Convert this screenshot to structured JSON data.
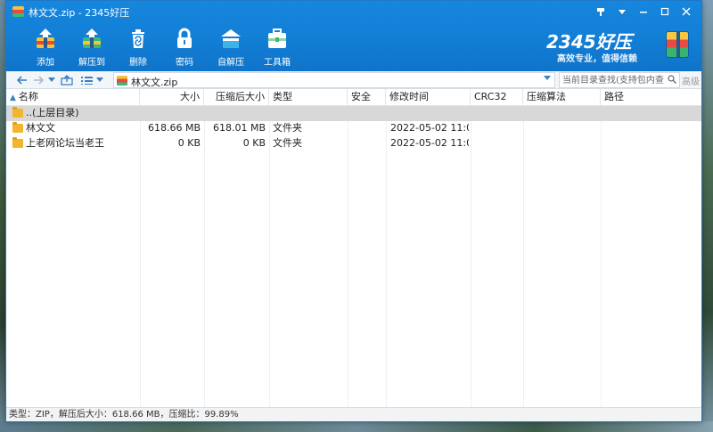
{
  "window": {
    "title": "林文文.zip - 2345好压",
    "controls": [
      "pin-icon",
      "menu-icon",
      "minimize-icon",
      "maximize-icon",
      "close-icon"
    ]
  },
  "toolbar": {
    "items": [
      {
        "label": "添加",
        "icon": "add-archive-icon"
      },
      {
        "label": "解压到",
        "icon": "extract-to-icon"
      },
      {
        "label": "删除",
        "icon": "delete-icon"
      },
      {
        "label": "密码",
        "icon": "lock-icon"
      },
      {
        "label": "自解压",
        "icon": "self-extract-icon"
      },
      {
        "label": "工具箱",
        "icon": "toolbox-icon"
      }
    ]
  },
  "brand": {
    "logo": "2345好压",
    "slogan": "高效专业，值得信赖"
  },
  "address": {
    "path": "林文文.zip",
    "search_placeholder": "当前目录查找(支持包内查",
    "advanced_label": "高级"
  },
  "columns": [
    "名称",
    "大小",
    "压缩后大小",
    "类型",
    "安全",
    "修改时间",
    "CRC32",
    "压缩算法",
    "路径"
  ],
  "rows": [
    {
      "name": "..(上层目录)",
      "size": "",
      "packed": "",
      "type": "",
      "security": "",
      "modified": "",
      "crc": "",
      "method": "",
      "path": "",
      "selected": true
    },
    {
      "name": "林文文",
      "size": "618.66 MB",
      "packed": "618.01 MB",
      "type": "文件夹",
      "security": "",
      "modified": "2022-05-02 11:0...",
      "crc": "",
      "method": "",
      "path": "",
      "selected": false
    },
    {
      "name": "上老网论坛当老王",
      "size": "0 KB",
      "packed": "0 KB",
      "type": "文件夹",
      "security": "",
      "modified": "2022-05-02 11:0...",
      "crc": "",
      "method": "",
      "path": "",
      "selected": false
    }
  ],
  "status": {
    "text": "类型：ZIP，解压后大小：618.66 MB，压缩比：99.89%"
  },
  "colors": {
    "header_blue": "#137fd6",
    "nav_blue": "#3b7fc4",
    "folder_yellow": "#f2b52e",
    "selected_row": "#d8d8d8"
  }
}
